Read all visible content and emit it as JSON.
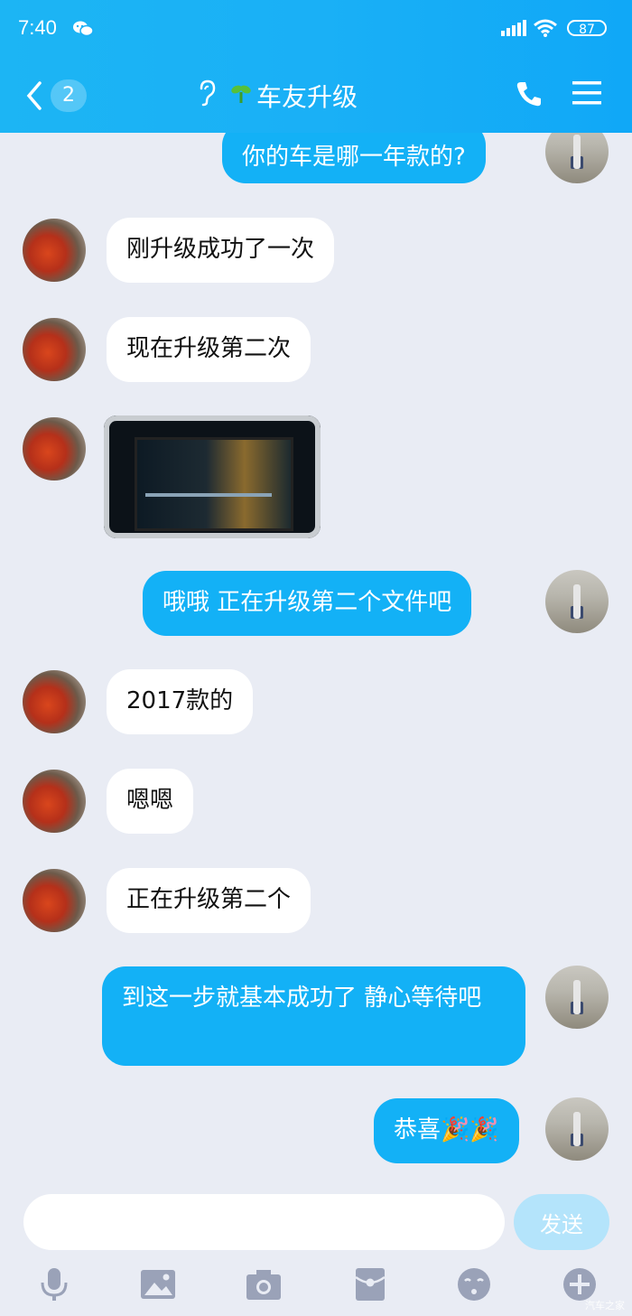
{
  "status_bar": {
    "time": "7:40",
    "battery": "87"
  },
  "header": {
    "unread_count": "2",
    "title": "车友升级"
  },
  "messages": [
    {
      "side": "out",
      "text": "你的车是哪一年款的?"
    },
    {
      "side": "in",
      "text": "刚升级成功了一次"
    },
    {
      "side": "in",
      "text": "现在升级第二次"
    },
    {
      "side": "in",
      "type": "image",
      "text": ""
    },
    {
      "side": "out",
      "text": "哦哦  正在升级第二个文件吧"
    },
    {
      "side": "in",
      "text": "2017款的"
    },
    {
      "side": "in",
      "text": "嗯嗯"
    },
    {
      "side": "in",
      "text": "正在升级第二个"
    },
    {
      "side": "out",
      "text": "到这一步就基本成功了  静心等待吧"
    },
    {
      "side": "out",
      "text": "恭喜🎉🎉"
    }
  ],
  "composer": {
    "input_value": "",
    "send_label": "发送"
  },
  "toolbar_icons": [
    "microphone-icon",
    "image-icon",
    "camera-icon",
    "red-packet-icon",
    "emoji-icon",
    "plus-icon"
  ],
  "watermark": "汽车之家",
  "colors": {
    "header_bg": "#1ab0f6",
    "outgoing_bubble": "#13b1f6",
    "incoming_bubble": "#ffffff",
    "chat_bg": "#e9ecf4"
  }
}
